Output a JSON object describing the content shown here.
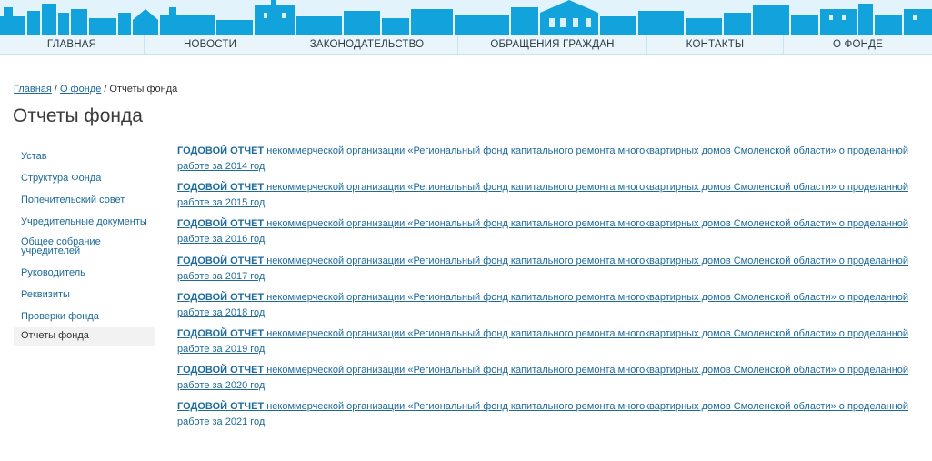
{
  "nav": {
    "items": [
      "ГЛАВНАЯ",
      "НОВОСТИ",
      "ЗАКОНОДАТЕЛЬСТВО",
      "ОБРАЩЕНИЯ ГРАЖДАН",
      "КОНТАКТЫ",
      "О ФОНДЕ"
    ]
  },
  "breadcrumb": {
    "home": "Главная",
    "sep1": "/",
    "about": "О фонде",
    "sep2": "/",
    "current": "Отчеты фонда"
  },
  "page_title": "Отчеты фонда",
  "sidebar": {
    "items": [
      {
        "label": "Устав"
      },
      {
        "label": "Структура Фонда"
      },
      {
        "label": "Попечительский совет"
      },
      {
        "label": "Учредительные документы"
      },
      {
        "label": "Общее собрание учредителей"
      },
      {
        "label": "Руководитель"
      },
      {
        "label": "Реквизиты"
      },
      {
        "label": "Проверки фонда"
      },
      {
        "label": "Отчеты фонда",
        "active": true
      }
    ]
  },
  "reports": [
    {
      "prefix": "ГОДОВОЙ ОТЧЕТ",
      "text": " некоммерческой организации «Региональный фонд капитального ремонта многоквартирных домов Смоленской области» о проделанной работе за 2014 год"
    },
    {
      "prefix": "ГОДОВОЙ ОТЧЕТ",
      "text": " некоммерческой организации «Региональный фонд капитального ремонта многоквартирных домов Смоленской области» о проделанной работе за 2015 год"
    },
    {
      "prefix": "ГОДОВОЙ ОТЧЕТ",
      "text": " некоммерческой организации «Региональный фонд капитального ремонта многоквартирных домов Смоленской области» о проделанной работе за 2016 год"
    },
    {
      "prefix": "ГОДОВОЙ ОТЧЕТ",
      "text": " некоммерческой организации «Региональный фонд капитального ремонта многоквартирных домов Смоленской области» о проделанной работе за 2017 год"
    },
    {
      "prefix": "ГОДОВОЙ ОТЧЕТ",
      "text": " некоммерческой организации «Региональный фонд капитального ремонта многоквартирных домов Смоленской области» о проделанной работе за 2018 год"
    },
    {
      "prefix": "ГОДОВОЙ ОТЧЕТ",
      "text": " некоммерческой организации «Региональный фонд капитального ремонта многоквартирных домов Смоленской области» о проделанной работе за 2019 год"
    },
    {
      "prefix": "ГОДОВОЙ ОТЧЕТ",
      "text": " некоммерческой организации «Региональный фонд капитального ремонта многоквартирных домов Смоленской области» о проделанной работе за 2020 год"
    },
    {
      "prefix": "ГОДОВОЙ ОТЧЕТ",
      "text": " некоммерческой организации «Региональный фонд капитального ремонта многоквартирных домов Смоленской области» о проделанной работе за 2021 год"
    }
  ],
  "colors": {
    "skyline": "#12a3dc",
    "link": "#1e6b9a",
    "nav_bg": "#eaf5fb"
  }
}
